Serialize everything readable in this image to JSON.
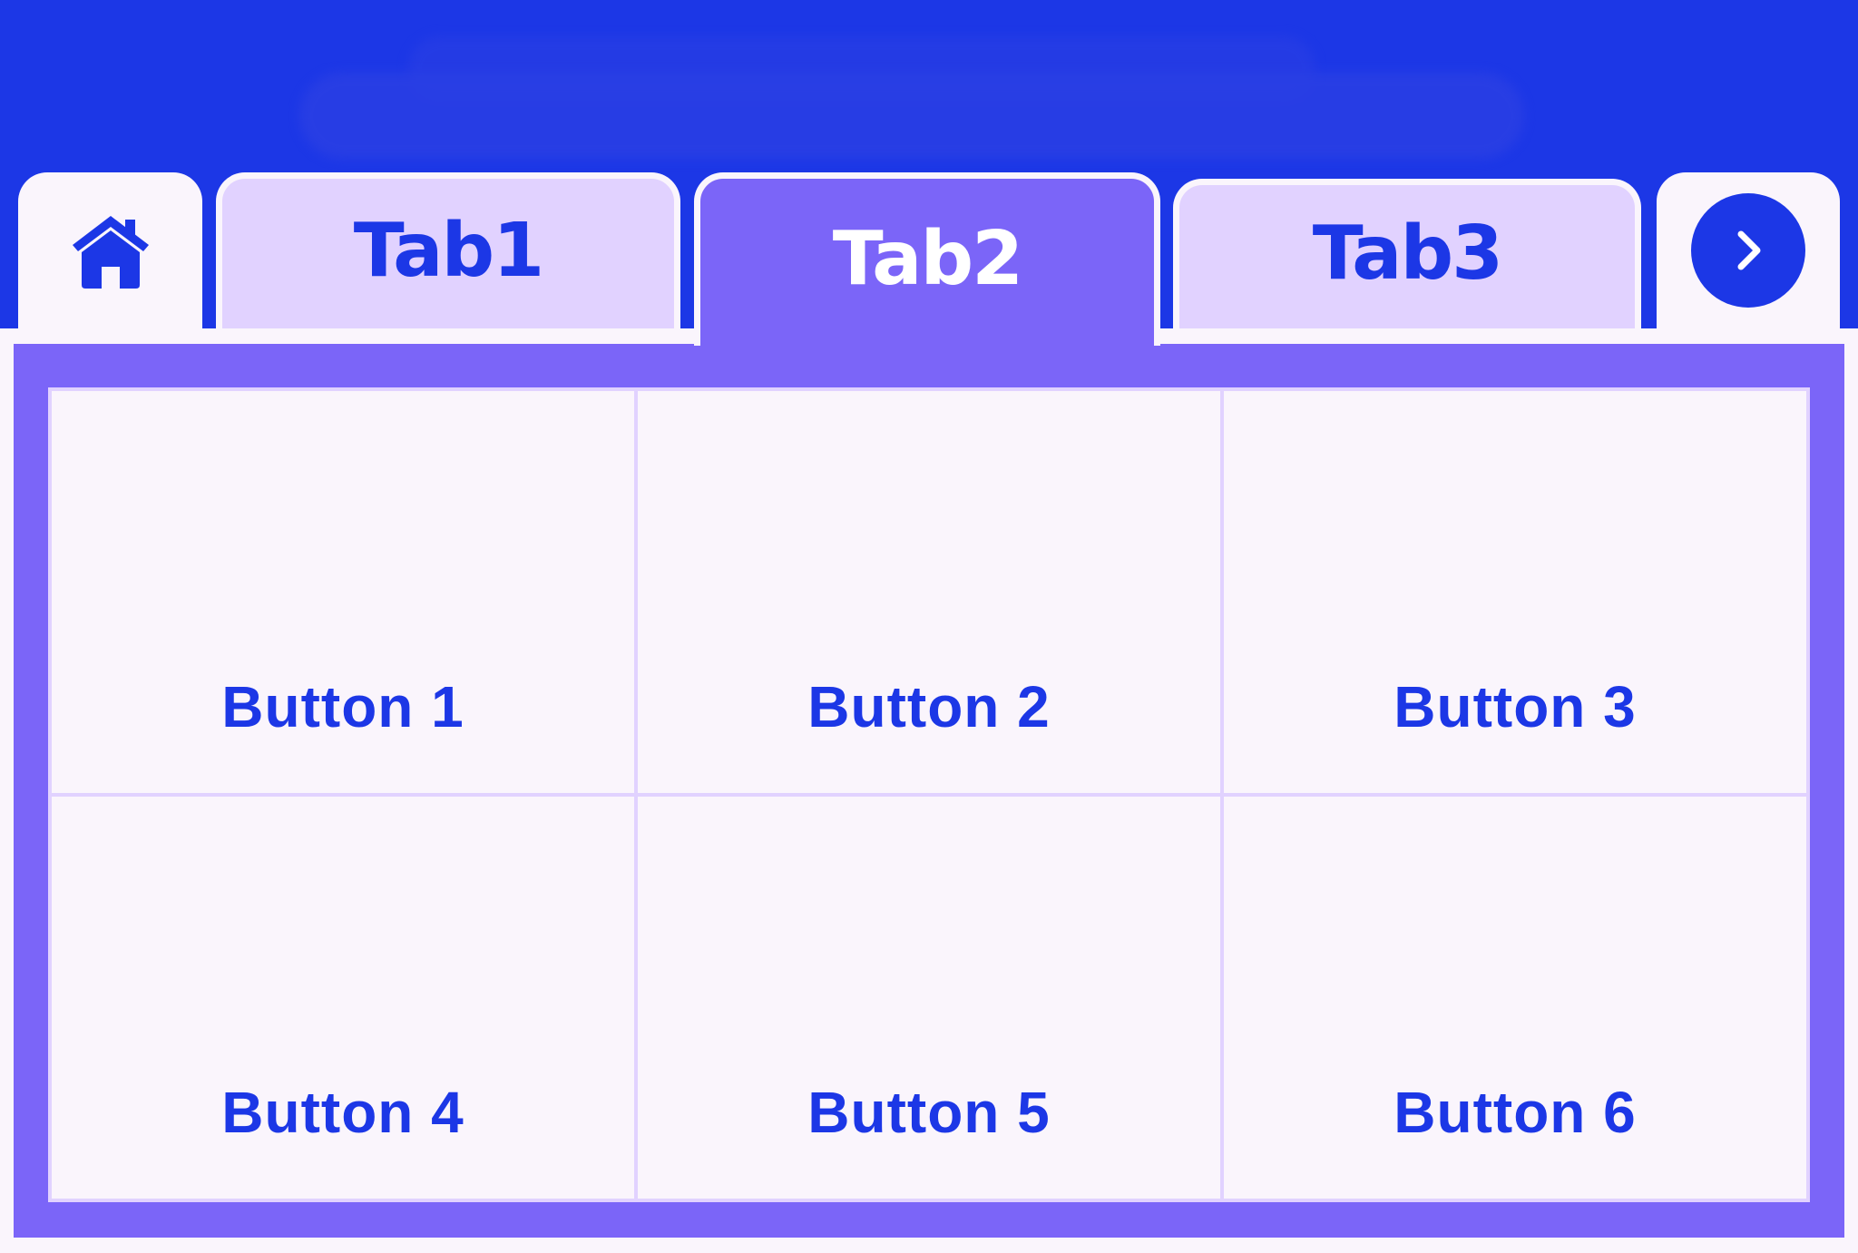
{
  "colors": {
    "header_blue": "#1c37e6",
    "active_tab": "#7b65f8",
    "inactive_tab": "#e1d2ff",
    "surface": "#faf5fc",
    "accent_text": "#1c37e6"
  },
  "tabs": {
    "home_icon": "home-icon",
    "items": [
      {
        "label": "Tab1",
        "active": false
      },
      {
        "label": "Tab2",
        "active": true
      },
      {
        "label": "Tab3",
        "active": false
      }
    ],
    "next_icon": "chevron-right-icon"
  },
  "grid": {
    "buttons": [
      {
        "label": "Button 1"
      },
      {
        "label": "Button 2"
      },
      {
        "label": "Button 3"
      },
      {
        "label": "Button 4"
      },
      {
        "label": "Button 5"
      },
      {
        "label": "Button 6"
      }
    ]
  }
}
